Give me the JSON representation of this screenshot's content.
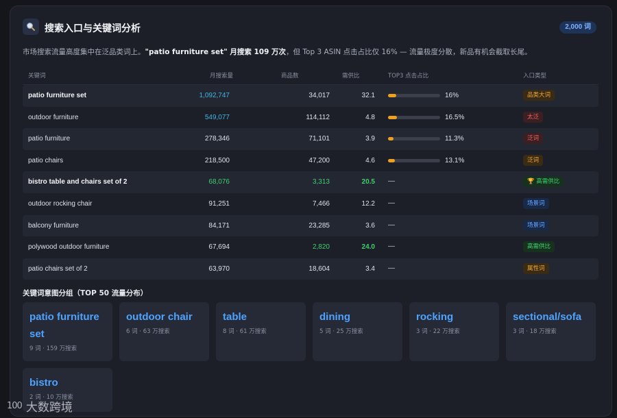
{
  "header": {
    "title": "搜索入口与关键词分析",
    "count_badge": "2,000 词",
    "icon": "magnifier-icon"
  },
  "summary": {
    "text_1": "市场搜索流量高度集中在泛品类词上。",
    "highlight": "\"patio furniture set\" 月搜索 109 万次",
    "text_2": "，但 Top 3 ASIN 点击占比仅 16% — 流量极度分散，新品有机会截取长尾。"
  },
  "table": {
    "columns": [
      "关键词",
      "月搜索量",
      "商品数",
      "需供比",
      "TOP3 点击占比",
      "入口类型"
    ],
    "rows": [
      {
        "keyword": "patio furniture set",
        "bold": true,
        "volume": "1,092,747",
        "volume_color": "#3fb5e6",
        "products": "34,017",
        "products_color": "#dde1e8",
        "ratio": "32.1",
        "ratio_color": "#dde1e8",
        "ratio_bold": false,
        "top3": 0.16,
        "top3_label": "16%",
        "tag": "品类大词",
        "tag_type": "orange"
      },
      {
        "keyword": "outdoor furniture",
        "bold": false,
        "volume": "549,077",
        "volume_color": "#3fb5e6",
        "products": "114,112",
        "products_color": "#dde1e8",
        "ratio": "4.8",
        "ratio_color": "#dde1e8",
        "ratio_bold": false,
        "top3": 0.165,
        "top3_label": "16.5%",
        "tag": "太泛",
        "tag_type": "red"
      },
      {
        "keyword": "patio furniture",
        "bold": false,
        "volume": "278,346",
        "volume_color": "#dde1e8",
        "products": "71,101",
        "products_color": "#dde1e8",
        "ratio": "3.9",
        "ratio_color": "#dde1e8",
        "ratio_bold": false,
        "top3": 0.113,
        "top3_label": "11.3%",
        "tag": "泛词",
        "tag_type": "red"
      },
      {
        "keyword": "patio chairs",
        "bold": false,
        "volume": "218,500",
        "volume_color": "#dde1e8",
        "products": "47,200",
        "products_color": "#dde1e8",
        "ratio": "4.6",
        "ratio_color": "#dde1e8",
        "ratio_bold": false,
        "top3": 0.131,
        "top3_label": "13.1%",
        "tag": "泛词",
        "tag_type": "orange"
      },
      {
        "keyword": "bistro table and chairs set of 2",
        "bold": true,
        "volume": "68,076",
        "volume_color": "#3ecf6e",
        "products": "3,313",
        "products_color": "#3ecf6e",
        "ratio": "20.5",
        "ratio_color": "#3ecf6e",
        "ratio_bold": true,
        "top3": null,
        "top3_label": "—",
        "tag": "🏆 高需供比",
        "tag_type": "green"
      },
      {
        "keyword": "outdoor rocking chair",
        "bold": false,
        "volume": "91,251",
        "volume_color": "#dde1e8",
        "products": "7,466",
        "products_color": "#dde1e8",
        "ratio": "12.2",
        "ratio_color": "#dde1e8",
        "ratio_bold": false,
        "top3": null,
        "top3_label": "—",
        "tag": "场景词",
        "tag_type": "blue"
      },
      {
        "keyword": "balcony furniture",
        "bold": false,
        "volume": "84,171",
        "volume_color": "#dde1e8",
        "products": "23,285",
        "products_color": "#dde1e8",
        "ratio": "3.6",
        "ratio_color": "#dde1e8",
        "ratio_bold": false,
        "top3": null,
        "top3_label": "—",
        "tag": "场景词",
        "tag_type": "blue"
      },
      {
        "keyword": "polywood outdoor furniture",
        "bold": false,
        "volume": "67,694",
        "volume_color": "#dde1e8",
        "products": "2,820",
        "products_color": "#3ecf6e",
        "ratio": "24.0",
        "ratio_color": "#3ecf6e",
        "ratio_bold": true,
        "top3": null,
        "top3_label": "—",
        "tag": "高需供比",
        "tag_type": "green"
      },
      {
        "keyword": "patio chairs set of 2",
        "bold": false,
        "volume": "63,970",
        "volume_color": "#dde1e8",
        "products": "18,604",
        "products_color": "#dde1e8",
        "ratio": "3.4",
        "ratio_color": "#dde1e8",
        "ratio_bold": false,
        "top3": null,
        "top3_label": "—",
        "tag": "属性词",
        "tag_type": "orange"
      }
    ]
  },
  "tag_colors": {
    "orange": {
      "bg": "#3a2c14",
      "fg": "#f0a63a"
    },
    "red": {
      "bg": "#3b1f22",
      "fg": "#f0645c"
    },
    "green": {
      "bg": "#16321f",
      "fg": "#42d173"
    },
    "blue": {
      "bg": "#182a48",
      "fg": "#64a4ff"
    }
  },
  "groups_section": {
    "title": "关键词意图分组（TOP 50 流量分布）",
    "groups": [
      {
        "name": "patio furniture set",
        "meta": "9 词 · 159 万搜索"
      },
      {
        "name": "outdoor chair",
        "meta": "6 词 · 63 万搜索"
      },
      {
        "name": "table",
        "meta": "8 词 · 61 万搜索"
      },
      {
        "name": "dining",
        "meta": "5 词 · 25 万搜索"
      },
      {
        "name": "rocking",
        "meta": "3 词 · 22 万搜索"
      },
      {
        "name": "sectional/sofa",
        "meta": "3 词 · 18 万搜索"
      },
      {
        "name": "bistro",
        "meta": "2 词 · 10 万搜索"
      }
    ]
  },
  "watermark": {
    "logo": "100",
    "text": "大数跨境"
  }
}
